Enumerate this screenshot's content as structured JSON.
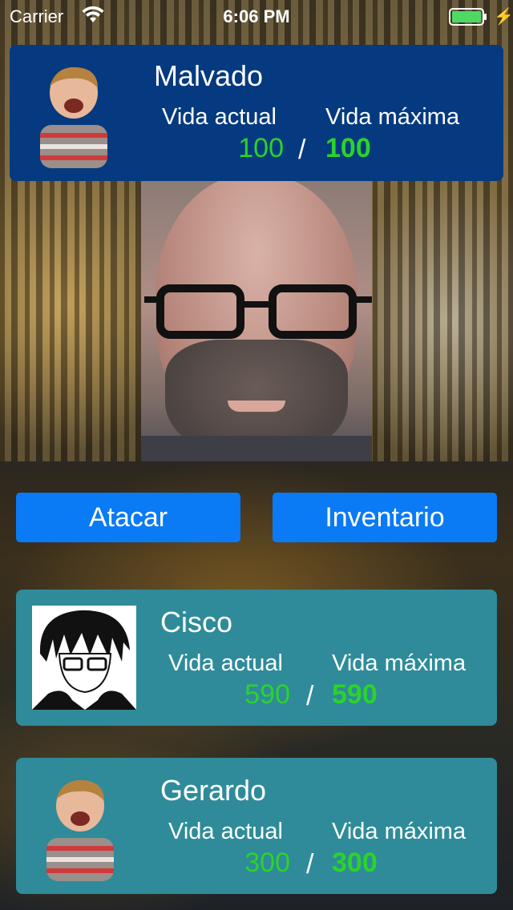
{
  "status_bar": {
    "carrier": "Carrier",
    "time": "6:06 PM",
    "battery_color": "#4cd964"
  },
  "enemy": {
    "name": "Malvado",
    "current_hp_label": "Vida actual",
    "max_hp_label": "Vida máxima",
    "current_hp": "100",
    "separator": "/",
    "max_hp": "100"
  },
  "actions": {
    "attack_label": "Atacar",
    "inventory_label": "Inventario"
  },
  "party": [
    {
      "name": "Cisco",
      "current_hp_label": "Vida actual",
      "max_hp_label": "Vida máxima",
      "current_hp": "590",
      "separator": "/",
      "max_hp": "590"
    },
    {
      "name": "Gerardo",
      "current_hp_label": "Vida actual",
      "max_hp_label": "Vida máxima",
      "current_hp": "300",
      "separator": "/",
      "max_hp": "300"
    }
  ],
  "colors": {
    "enemy_card_bg": "#053a80",
    "hero_card_bg": "#2f8b99",
    "button_bg": "#0a7af5",
    "hp_green": "#2bd32b"
  }
}
